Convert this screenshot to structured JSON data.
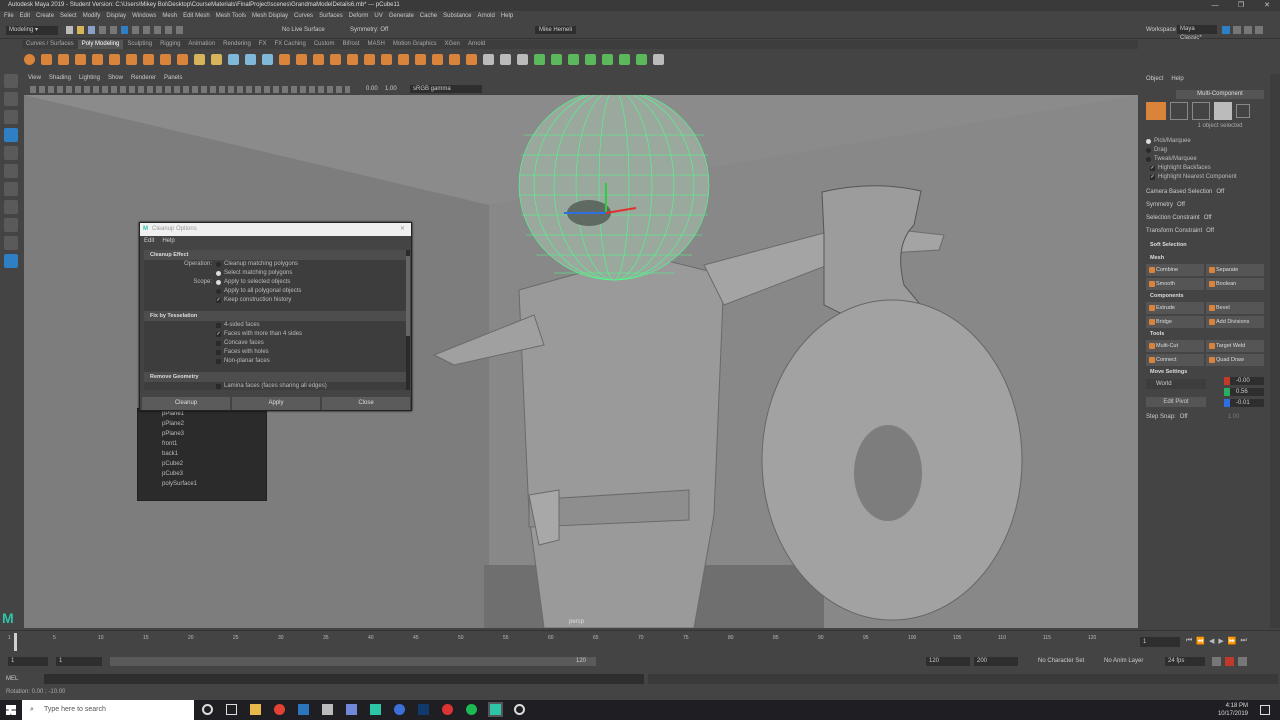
{
  "window": {
    "title": "Autodesk Maya 2019 - Student Version: C:\\Users\\Mikey Boi\\Desktop\\CourseMaterials\\FinalProject\\scenes\\GrandmaModelDetails6.mb* --- pCube11",
    "min": "—",
    "max": "❐",
    "close": "✕"
  },
  "menubar": [
    "File",
    "Edit",
    "Create",
    "Select",
    "Modify",
    "Display",
    "Windows",
    "Mesh",
    "Edit Mesh",
    "Mesh Tools",
    "Mesh Display",
    "Curves",
    "Surfaces",
    "Deform",
    "UV",
    "Generate",
    "Cache",
    "Substance",
    "Arnold",
    "Help"
  ],
  "status": {
    "mode": "Modeling",
    "live": "No Live Surface",
    "symmetry": "Symmetry: Off",
    "user": "Mike Hemeli",
    "workspace_label": "Workspace :",
    "workspace": "Maya Classic*"
  },
  "shelf_tabs": [
    "Curves / Surfaces",
    "Poly Modeling",
    "Sculpting",
    "Rigging",
    "Animation",
    "Rendering",
    "FX",
    "FX Caching",
    "Custom",
    "Bifrost",
    "MASH",
    "Motion Graphics",
    "XGen",
    "Arnold"
  ],
  "shelf_active": 1,
  "viewport": {
    "menu": [
      "View",
      "Shading",
      "Lighting",
      "Show",
      "Renderer",
      "Panels"
    ],
    "gamma": "sRGB gamma",
    "exposure": "0.00",
    "gamma_val": "1.00",
    "camera_label": "persp"
  },
  "dialog": {
    "title": "Cleanup Options",
    "menu": [
      "Edit",
      "Help"
    ],
    "sections": {
      "effect": "Cleanup Effect",
      "tess": "Fix by Tesselation",
      "remove": "Remove Geometry"
    },
    "operation_label": "Operation:",
    "op1": "Cleanup matching polygons",
    "op2": "Select matching polygons",
    "scope_label": "Scope:",
    "scope1": "Apply to selected objects",
    "scope2": "Apply to all polygonal objects",
    "history": "Keep construction history",
    "t1": "4-sided faces",
    "t2": "Faces with more than 4 sides",
    "t3": "Concave faces",
    "t4": "Faces with holes",
    "t5": "Non-planar faces",
    "r1": "Lamina faces (faces sharing all edges)",
    "buttons": [
      "Cleanup",
      "Apply",
      "Close"
    ]
  },
  "outliner": [
    "pPlane1",
    "pPlane2",
    "pPlane3",
    "front1",
    "back1",
    "pCube2",
    "pCube3",
    "polySurface1"
  ],
  "right_panel": {
    "tabs": [
      "Object",
      "Help"
    ],
    "mode": "Multi-Component",
    "selected": "1 object selected",
    "opts": [
      "Pick/Marquee",
      "Drag",
      "Tweak/Marquee"
    ],
    "checks": [
      "Highlight Backfaces",
      "Highlight Nearest Component"
    ],
    "camera_sel": "Camera Based Selection",
    "symmetry": "Symmetry",
    "sel_constraint": "Selection Constraint",
    "transform_constraint": "Transform Constraint",
    "off": "Off",
    "soft": "Soft Selection",
    "mesh": "Mesh",
    "mesh_btns": [
      "Combine",
      "Separate",
      "Smooth",
      "Boolean"
    ],
    "components": "Components",
    "comp_btns": [
      "Extrude",
      "Bevel",
      "Bridge",
      "Add Divisions"
    ],
    "tools": "Tools",
    "tool_btns": [
      "Multi-Cut",
      "Target Weld",
      "Connect",
      "Quad Draw"
    ],
    "move": "Move Settings",
    "world": "World",
    "xyz": [
      "-0.00",
      "0.56",
      "-0.01"
    ],
    "edit_pivot": "Edit Pivot",
    "step_snap": "Step Snap:",
    "step_val": "1.00"
  },
  "timeline": {
    "frames": [
      "1",
      "5",
      "10",
      "15",
      "20",
      "25",
      "30",
      "35",
      "40",
      "45",
      "50",
      "55",
      "60",
      "65",
      "70",
      "75",
      "80",
      "85",
      "90",
      "95",
      "100",
      "105",
      "110",
      "115",
      "120"
    ],
    "current": "1"
  },
  "range": {
    "start": "1",
    "start2": "1",
    "end_inner": "120",
    "end": "120",
    "end2": "200",
    "charset": "No Character Set",
    "animlayer": "No Anim Layer",
    "fps": "24 fps"
  },
  "cmd": {
    "lang": "MEL",
    "result": "Rotation: 0.00 ; -10.00"
  },
  "taskbar": {
    "search": "Type here to search",
    "time": "4:18 PM",
    "date": "10/17/2019"
  },
  "colors": {
    "accent": "#2f7fc4",
    "wire": "#4cff8a",
    "orange": "#d9843a"
  }
}
